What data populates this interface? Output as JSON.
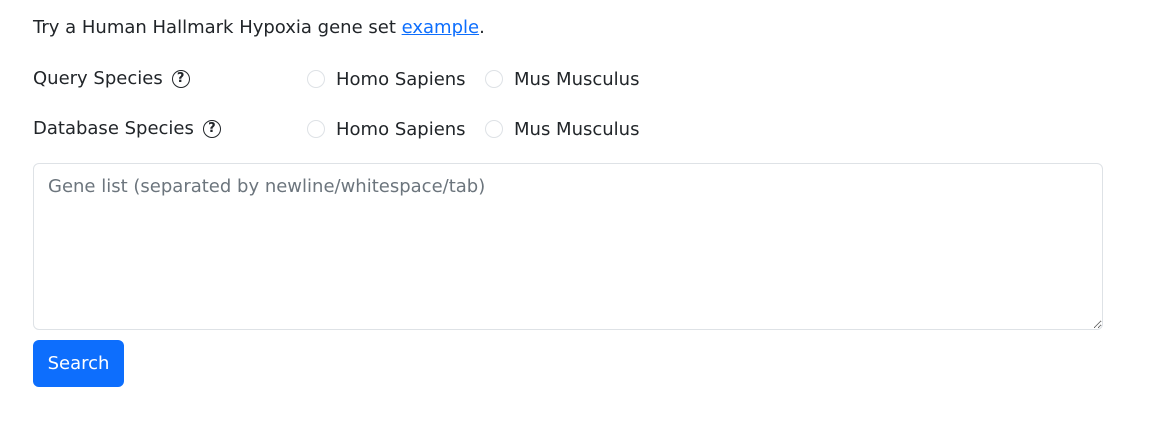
{
  "intro": {
    "prefix": "Try a Human Hallmark Hypoxia gene set ",
    "link_text": "example",
    "suffix": "."
  },
  "query_species": {
    "label": "Query Species",
    "help_icon": "question-circle-icon",
    "options": [
      "Homo Sapiens",
      "Mus Musculus"
    ]
  },
  "database_species": {
    "label": "Database Species",
    "help_icon": "question-circle-icon",
    "options": [
      "Homo Sapiens",
      "Mus Musculus"
    ]
  },
  "gene_list": {
    "value": "",
    "placeholder": "Gene list (separated by newline/whitespace/tab)"
  },
  "search_button": {
    "label": "Search"
  },
  "colors": {
    "accent": "#0d6efd",
    "text": "#212529",
    "border": "#dee2e6",
    "placeholder": "#6c757d"
  }
}
